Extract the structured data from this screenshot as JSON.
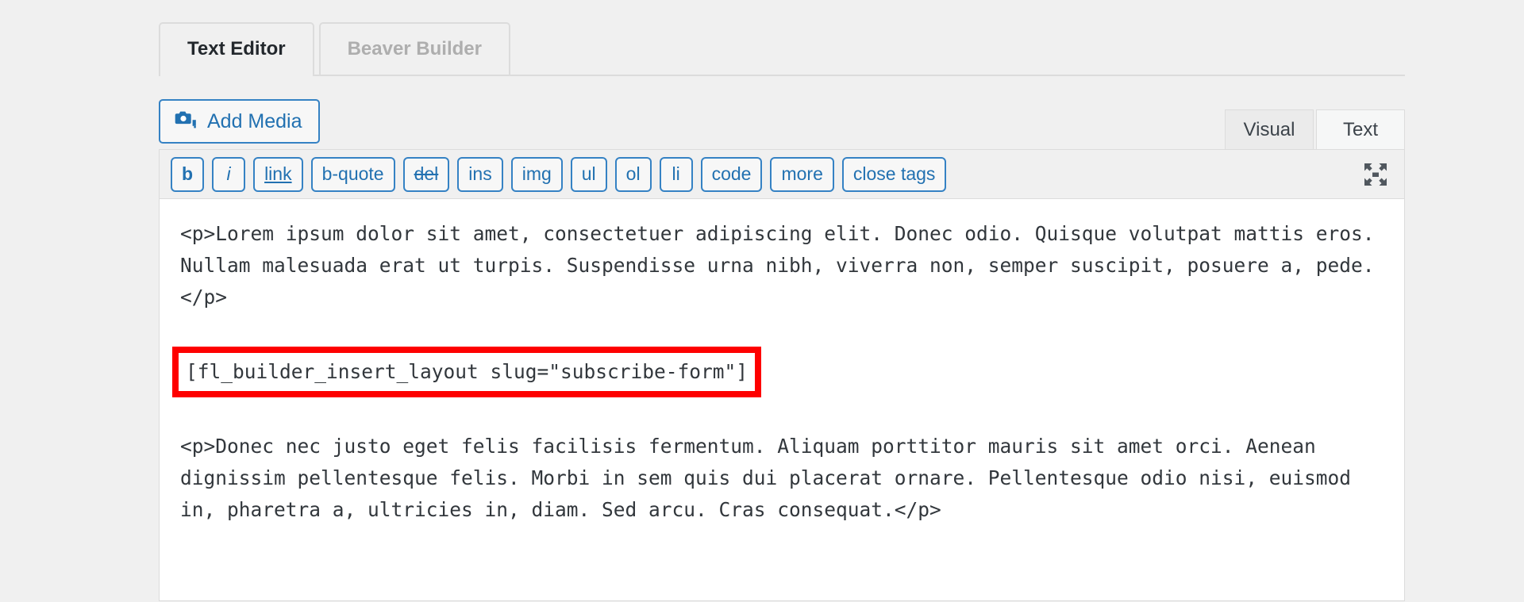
{
  "tabs": [
    {
      "label": "Text Editor",
      "active": true
    },
    {
      "label": "Beaver Builder",
      "active": false
    }
  ],
  "toolbar_media": {
    "add_media_label": "Add Media",
    "media_icon": "camera-icon",
    "accent_color": "#2271b1"
  },
  "view_switch": [
    {
      "label": "Visual",
      "active": false
    },
    {
      "label": "Text",
      "active": true
    }
  ],
  "quicktags": [
    {
      "label": "b",
      "style": "bold"
    },
    {
      "label": "i",
      "style": "italic"
    },
    {
      "label": "link",
      "style": "underline"
    },
    {
      "label": "b-quote",
      "style": "plain"
    },
    {
      "label": "del",
      "style": "strike"
    },
    {
      "label": "ins",
      "style": "plain"
    },
    {
      "label": "img",
      "style": "plain"
    },
    {
      "label": "ul",
      "style": "plain"
    },
    {
      "label": "ol",
      "style": "plain"
    },
    {
      "label": "li",
      "style": "plain"
    },
    {
      "label": "code",
      "style": "plain"
    },
    {
      "label": "more",
      "style": "plain"
    },
    {
      "label": "close tags",
      "style": "plain"
    }
  ],
  "distraction_free_icon": "fullscreen-expand-icon",
  "editor_content": {
    "paragraph_1": "<p>Lorem ipsum dolor sit amet, consectetuer adipiscing elit. Donec odio. Quisque volutpat mattis eros. Nullam malesuada erat ut turpis. Suspendisse urna nibh, viverra non, semper suscipit, posuere a, pede.</p>",
    "shortcode": "[fl_builder_insert_layout slug=\"subscribe-form\"]",
    "paragraph_2": "<p>Donec nec justo eget felis facilisis fermentum. Aliquam porttitor mauris sit amet orci. Aenean dignissim pellentesque felis. Morbi in sem quis dui placerat ornare. Pellentesque odio nisi, euismod in, pharetra a, ultricies in, diam. Sed arcu. Cras consequat.</p>"
  },
  "annotation": {
    "highlight_color": "#fe0000",
    "target": "shortcode"
  }
}
